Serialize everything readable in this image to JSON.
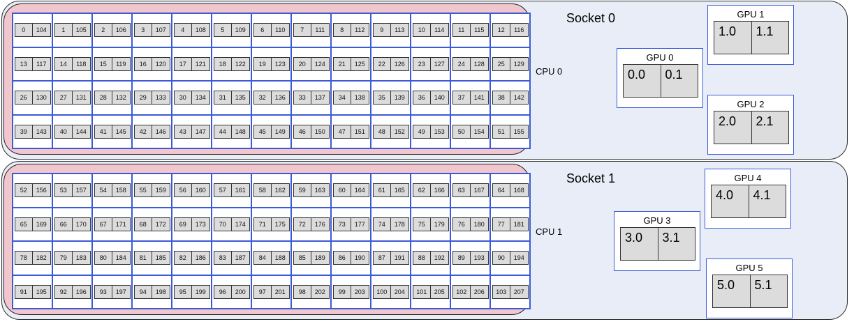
{
  "colors": {
    "socket_fill": "#e9edf7",
    "cpu_fill": "#f1c6cc",
    "grid_line": "#3b5bd6",
    "core_fill": "#dcdcdc"
  },
  "sockets": [
    {
      "label": "Socket 0",
      "cpu_label": "CPU 0",
      "cores": [
        [
          "0",
          "104"
        ],
        [
          "1",
          "105"
        ],
        [
          "2",
          "106"
        ],
        [
          "3",
          "107"
        ],
        [
          "4",
          "108"
        ],
        [
          "5",
          "109"
        ],
        [
          "6",
          "110"
        ],
        [
          "7",
          "111"
        ],
        [
          "8",
          "112"
        ],
        [
          "9",
          "113"
        ],
        [
          "10",
          "114"
        ],
        [
          "11",
          "115"
        ],
        [
          "12",
          "116"
        ],
        [
          "13",
          "117"
        ],
        [
          "14",
          "118"
        ],
        [
          "15",
          "119"
        ],
        [
          "16",
          "120"
        ],
        [
          "17",
          "121"
        ],
        [
          "18",
          "122"
        ],
        [
          "19",
          "123"
        ],
        [
          "20",
          "124"
        ],
        [
          "21",
          "125"
        ],
        [
          "22",
          "126"
        ],
        [
          "23",
          "127"
        ],
        [
          "24",
          "128"
        ],
        [
          "25",
          "129"
        ],
        [
          "26",
          "130"
        ],
        [
          "27",
          "131"
        ],
        [
          "28",
          "132"
        ],
        [
          "29",
          "133"
        ],
        [
          "30",
          "134"
        ],
        [
          "31",
          "135"
        ],
        [
          "32",
          "136"
        ],
        [
          "33",
          "137"
        ],
        [
          "34",
          "138"
        ],
        [
          "35",
          "139"
        ],
        [
          "36",
          "140"
        ],
        [
          "37",
          "141"
        ],
        [
          "38",
          "142"
        ],
        [
          "39",
          "143"
        ],
        [
          "40",
          "144"
        ],
        [
          "41",
          "145"
        ],
        [
          "42",
          "146"
        ],
        [
          "43",
          "147"
        ],
        [
          "44",
          "148"
        ],
        [
          "45",
          "149"
        ],
        [
          "46",
          "150"
        ],
        [
          "47",
          "151"
        ],
        [
          "48",
          "152"
        ],
        [
          "49",
          "153"
        ],
        [
          "50",
          "154"
        ],
        [
          "51",
          "155"
        ]
      ],
      "gpus": [
        {
          "label": "GPU 0",
          "parts": [
            "0.0",
            "0.1"
          ]
        },
        {
          "label": "GPU 1",
          "parts": [
            "1.0",
            "1.1"
          ]
        },
        {
          "label": "GPU 2",
          "parts": [
            "2.0",
            "2.1"
          ]
        }
      ]
    },
    {
      "label": "Socket 1",
      "cpu_label": "CPU 1",
      "cores": [
        [
          "52",
          "156"
        ],
        [
          "53",
          "157"
        ],
        [
          "54",
          "158"
        ],
        [
          "55",
          "159"
        ],
        [
          "56",
          "160"
        ],
        [
          "57",
          "161"
        ],
        [
          "58",
          "162"
        ],
        [
          "59",
          "163"
        ],
        [
          "60",
          "164"
        ],
        [
          "61",
          "165"
        ],
        [
          "62",
          "166"
        ],
        [
          "63",
          "167"
        ],
        [
          "64",
          "168"
        ],
        [
          "65",
          "169"
        ],
        [
          "66",
          "170"
        ],
        [
          "67",
          "171"
        ],
        [
          "68",
          "172"
        ],
        [
          "69",
          "173"
        ],
        [
          "70",
          "174"
        ],
        [
          "71",
          "175"
        ],
        [
          "72",
          "176"
        ],
        [
          "73",
          "177"
        ],
        [
          "74",
          "178"
        ],
        [
          "75",
          "179"
        ],
        [
          "76",
          "180"
        ],
        [
          "77",
          "181"
        ],
        [
          "78",
          "182"
        ],
        [
          "79",
          "183"
        ],
        [
          "80",
          "184"
        ],
        [
          "81",
          "185"
        ],
        [
          "82",
          "186"
        ],
        [
          "83",
          "187"
        ],
        [
          "84",
          "188"
        ],
        [
          "85",
          "189"
        ],
        [
          "86",
          "190"
        ],
        [
          "87",
          "191"
        ],
        [
          "88",
          "192"
        ],
        [
          "89",
          "193"
        ],
        [
          "90",
          "194"
        ],
        [
          "91",
          "195"
        ],
        [
          "92",
          "196"
        ],
        [
          "93",
          "197"
        ],
        [
          "94",
          "198"
        ],
        [
          "95",
          "199"
        ],
        [
          "96",
          "200"
        ],
        [
          "97",
          "201"
        ],
        [
          "98",
          "202"
        ],
        [
          "99",
          "203"
        ],
        [
          "100",
          "204"
        ],
        [
          "101",
          "205"
        ],
        [
          "102",
          "206"
        ],
        [
          "103",
          "207"
        ]
      ],
      "gpus": [
        {
          "label": "GPU 3",
          "parts": [
            "3.0",
            "3.1"
          ]
        },
        {
          "label": "GPU 4",
          "parts": [
            "4.0",
            "4.1"
          ]
        },
        {
          "label": "GPU 5",
          "parts": [
            "5.0",
            "5.1"
          ]
        }
      ]
    }
  ]
}
